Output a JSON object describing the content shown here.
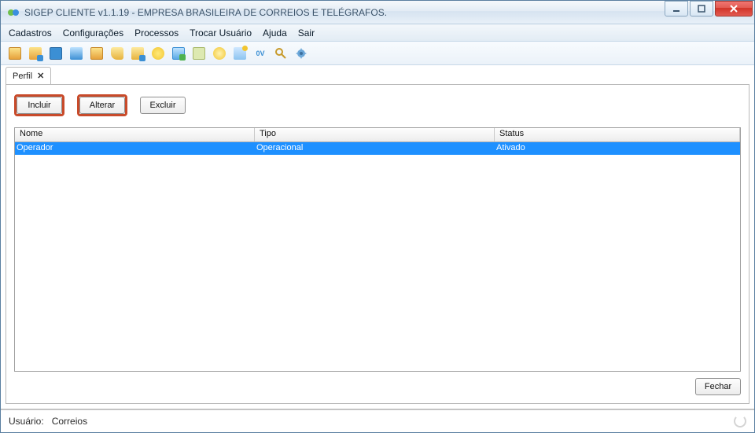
{
  "window": {
    "title": "SIGEP CLIENTE v1.1.19 - EMPRESA BRASILEIRA DE CORREIOS E TELÉGRAFOS."
  },
  "menu": {
    "items": [
      "Cadastros",
      "Configurações",
      "Processos",
      "Trocar Usuário",
      "Ajuda",
      "Sair"
    ]
  },
  "toolbar": {
    "icons": [
      "icon01",
      "icon02",
      "icon03",
      "icon04",
      "icon05",
      "icon06",
      "icon07",
      "icon08",
      "icon09",
      "icon10",
      "icon11",
      "icon12",
      "icon13",
      "icon14",
      "icon15"
    ]
  },
  "tab": {
    "label": "Perfil",
    "close": "✕"
  },
  "actions": {
    "incluir": "Incluir",
    "alterar": "Alterar",
    "excluir": "Excluir",
    "fechar": "Fechar"
  },
  "table": {
    "headers": {
      "nome": "Nome",
      "tipo": "Tipo",
      "status": "Status"
    },
    "rows": [
      {
        "nome": "Operador",
        "tipo": "Operacional",
        "status": "Ativado",
        "selected": true
      }
    ]
  },
  "statusbar": {
    "user_label": "Usuário:",
    "user_value": "Correios"
  }
}
